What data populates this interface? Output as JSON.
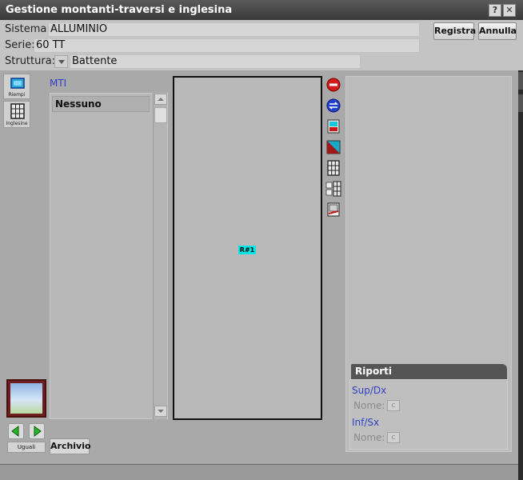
{
  "window": {
    "title": "Gestione montanti-traversi e inglesina",
    "help_label": "?",
    "close_label": "✕"
  },
  "header": {
    "sistema_label": "Sistema:",
    "sistema_value": "ALLUMINIO",
    "serie_label": "Serie:",
    "serie_value": "60 TT",
    "struttura_label": "Struttura:",
    "struttura_value": "Battente",
    "registra_label": "Registra",
    "annulla_label": "Annulla"
  },
  "left_tools": {
    "riempi_label": "Riempi",
    "inglesine_label": "Inglesine"
  },
  "mti": {
    "label": "MTI",
    "items": [
      "Nessuno"
    ]
  },
  "canvas": {
    "region_label": "R#1",
    "region_color": "#00e6e6"
  },
  "tool_icons": [
    "delete-icon",
    "swap-icon",
    "split-vertical-icon",
    "diagonal-icon",
    "grid-icon",
    "on-off-grid-icon",
    "edit-frame-icon"
  ],
  "riporti": {
    "title": "Riporti",
    "sup_dx_label": "Sup/Dx",
    "inf_sx_label": "Inf/Sx",
    "nome_label_1": "Nome:",
    "nome_label_2": "Nome:",
    "c_label_1": "c",
    "c_label_2": "c"
  },
  "bottom_left": {
    "uguali_label": "Uguali",
    "archivio_label": "Archivio"
  },
  "colors": {
    "accent_blue": "#2f3fc8",
    "titlebar": "#3a3a3a"
  }
}
